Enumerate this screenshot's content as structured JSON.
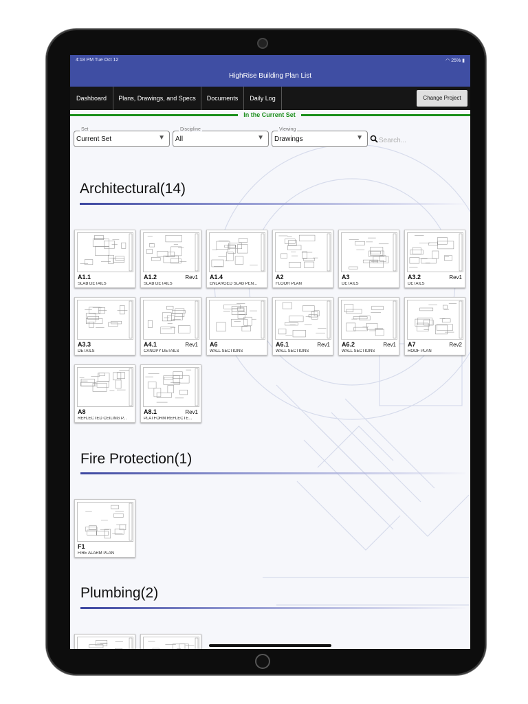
{
  "status_bar": {
    "time": "4:18 PM  Tue Oct 12",
    "battery": "25%"
  },
  "header": {
    "title": "HighRise Building Plan List"
  },
  "nav": {
    "tabs": [
      {
        "label": "Dashboard"
      },
      {
        "label": "Plans, Drawings, and Specs"
      },
      {
        "label": "Documents"
      },
      {
        "label": "Daily Log"
      }
    ],
    "change_project": "Change Project"
  },
  "current_set_banner": "In the Current Set",
  "filters": {
    "set": {
      "label": "Set",
      "value": "Current Set"
    },
    "discipline": {
      "label": "Discipline",
      "value": "All"
    },
    "viewing": {
      "label": "Viewing",
      "value": "Drawings"
    },
    "search_placeholder": "Search..."
  },
  "sections": [
    {
      "title": "Architectural(14)",
      "sheets": [
        {
          "number": "A1.1",
          "rev": "",
          "name": "SLAB DETAILS"
        },
        {
          "number": "A1.2",
          "rev": "Rev1",
          "name": "SLAB DETAILS"
        },
        {
          "number": "A1.4",
          "rev": "",
          "name": "ENLARGED SLAB PEN..."
        },
        {
          "number": "A2",
          "rev": "",
          "name": "FLOOR PLAN"
        },
        {
          "number": "A3",
          "rev": "",
          "name": "DETAILS"
        },
        {
          "number": "A3.2",
          "rev": "Rev1",
          "name": "DETAILS"
        },
        {
          "number": "A3.3",
          "rev": "",
          "name": "DETAILS"
        },
        {
          "number": "A4.1",
          "rev": "Rev1",
          "name": "CANOPY DETAILS"
        },
        {
          "number": "A6",
          "rev": "",
          "name": "WALL SECTIONS"
        },
        {
          "number": "A6.1",
          "rev": "Rev1",
          "name": "WALL SECTIONS"
        },
        {
          "number": "A6.2",
          "rev": "Rev1",
          "name": "WALL SECTIONS"
        },
        {
          "number": "A7",
          "rev": "Rev2",
          "name": "ROOF PLAN"
        },
        {
          "number": "A8",
          "rev": "",
          "name": "REFLECTED CEILING P..."
        },
        {
          "number": "A8.1",
          "rev": "Rev1",
          "name": "PLATFORM REFLECTE..."
        }
      ]
    },
    {
      "title": "Fire Protection(1)",
      "sheets": [
        {
          "number": "F1",
          "rev": "",
          "name": "FIRE ALARM PLAN"
        }
      ]
    },
    {
      "title": "Plumbing(2)",
      "sheets": [
        {
          "number": "",
          "rev": "",
          "name": ""
        },
        {
          "number": "",
          "rev": "",
          "name": ""
        }
      ]
    }
  ],
  "colors": {
    "header": "#3f4ea3",
    "nav": "#161616",
    "banner": "#1b8f1b",
    "accent": "#3c46a0"
  }
}
